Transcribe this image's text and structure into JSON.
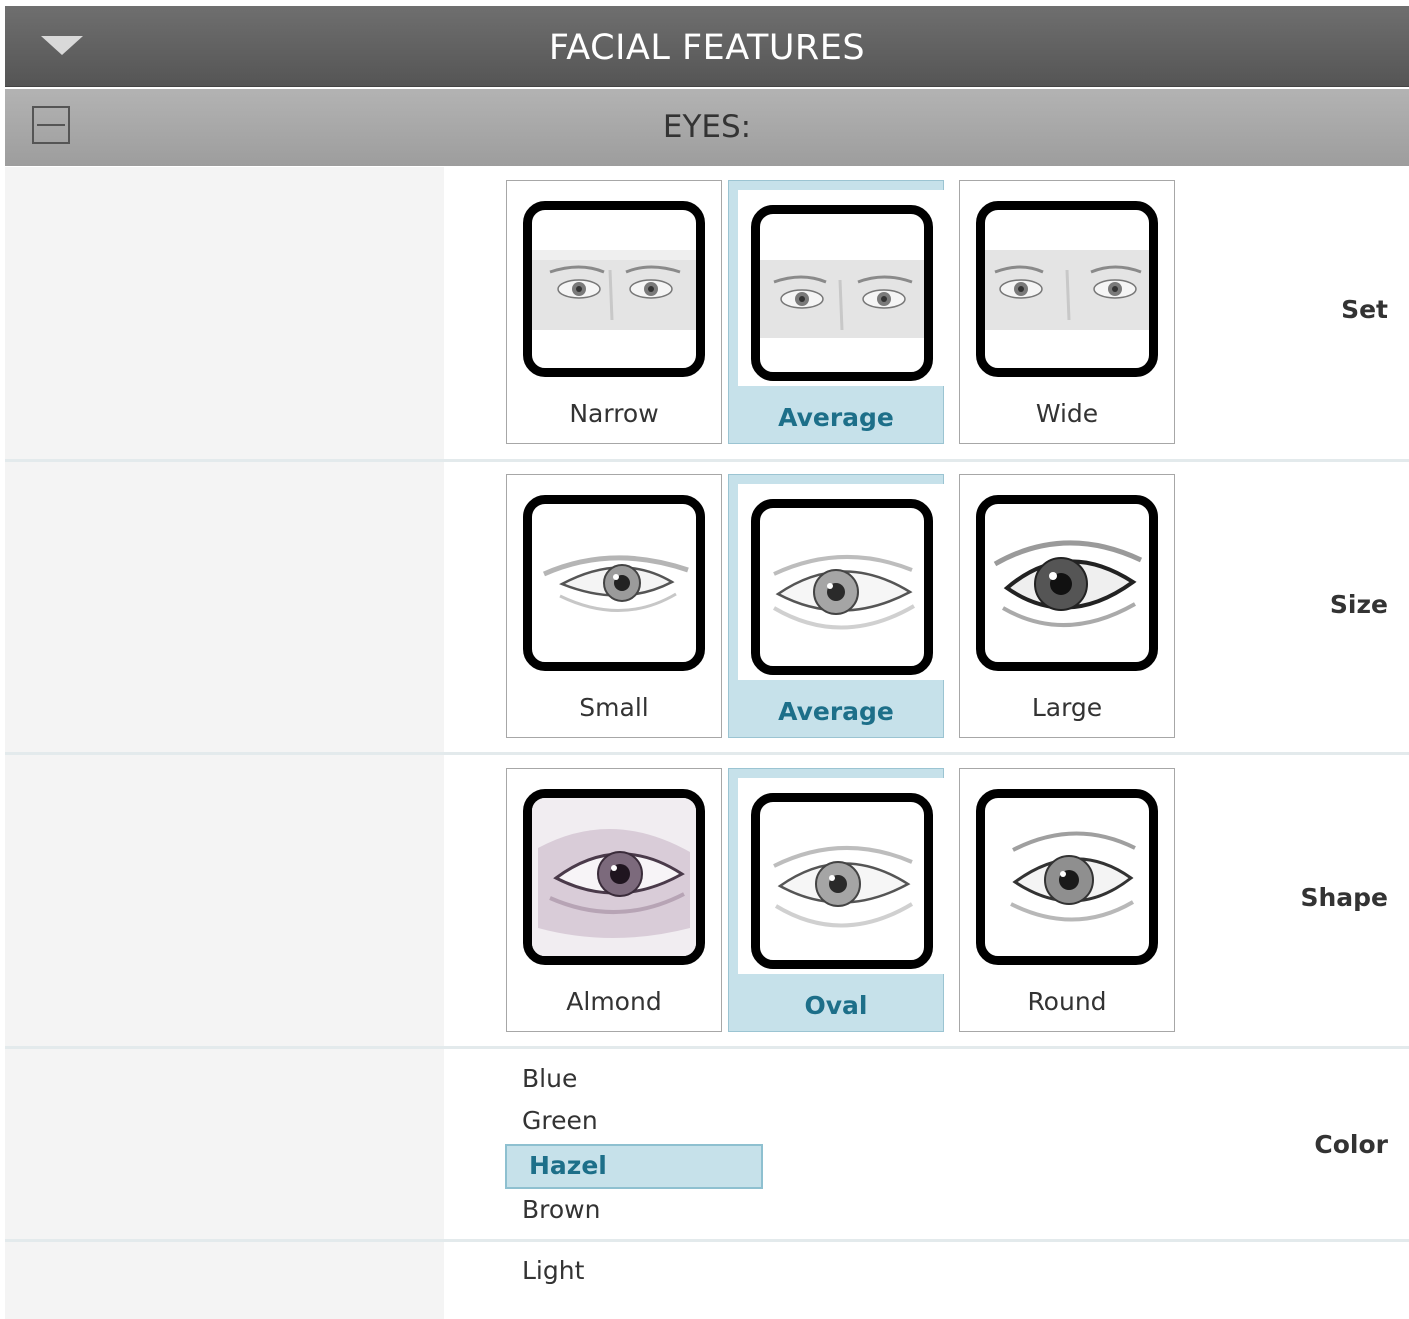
{
  "header": {
    "title": "FACIAL FEATURES"
  },
  "section": {
    "title": "EYES:"
  },
  "rows": {
    "set": {
      "label": "Set",
      "options": [
        {
          "caption": "Narrow",
          "selected": false,
          "icon": "eyes-narrow-icon"
        },
        {
          "caption": "Average",
          "selected": true,
          "icon": "eyes-average-icon"
        },
        {
          "caption": "Wide",
          "selected": false,
          "icon": "eyes-wide-icon"
        }
      ]
    },
    "size": {
      "label": "Size",
      "options": [
        {
          "caption": "Small",
          "selected": false,
          "icon": "eye-small-icon"
        },
        {
          "caption": "Average",
          "selected": true,
          "icon": "eye-average-icon"
        },
        {
          "caption": "Large",
          "selected": false,
          "icon": "eye-large-icon"
        }
      ]
    },
    "shape": {
      "label": "Shape",
      "options": [
        {
          "caption": "Almond",
          "selected": false,
          "icon": "eye-almond-icon"
        },
        {
          "caption": "Oval",
          "selected": true,
          "icon": "eye-oval-icon"
        },
        {
          "caption": "Round",
          "selected": false,
          "icon": "eye-round-icon"
        }
      ]
    },
    "color": {
      "label": "Color",
      "options": [
        "Blue",
        "Green",
        "Hazel",
        "Brown"
      ],
      "selected": "Hazel"
    },
    "tone": {
      "options": [
        "Light"
      ]
    }
  },
  "colors": {
    "selected_bg": "#c6e1ea",
    "selected_text": "#1d6f89",
    "header_bg": "#636363",
    "subheader_bg": "#a8a8a8"
  }
}
